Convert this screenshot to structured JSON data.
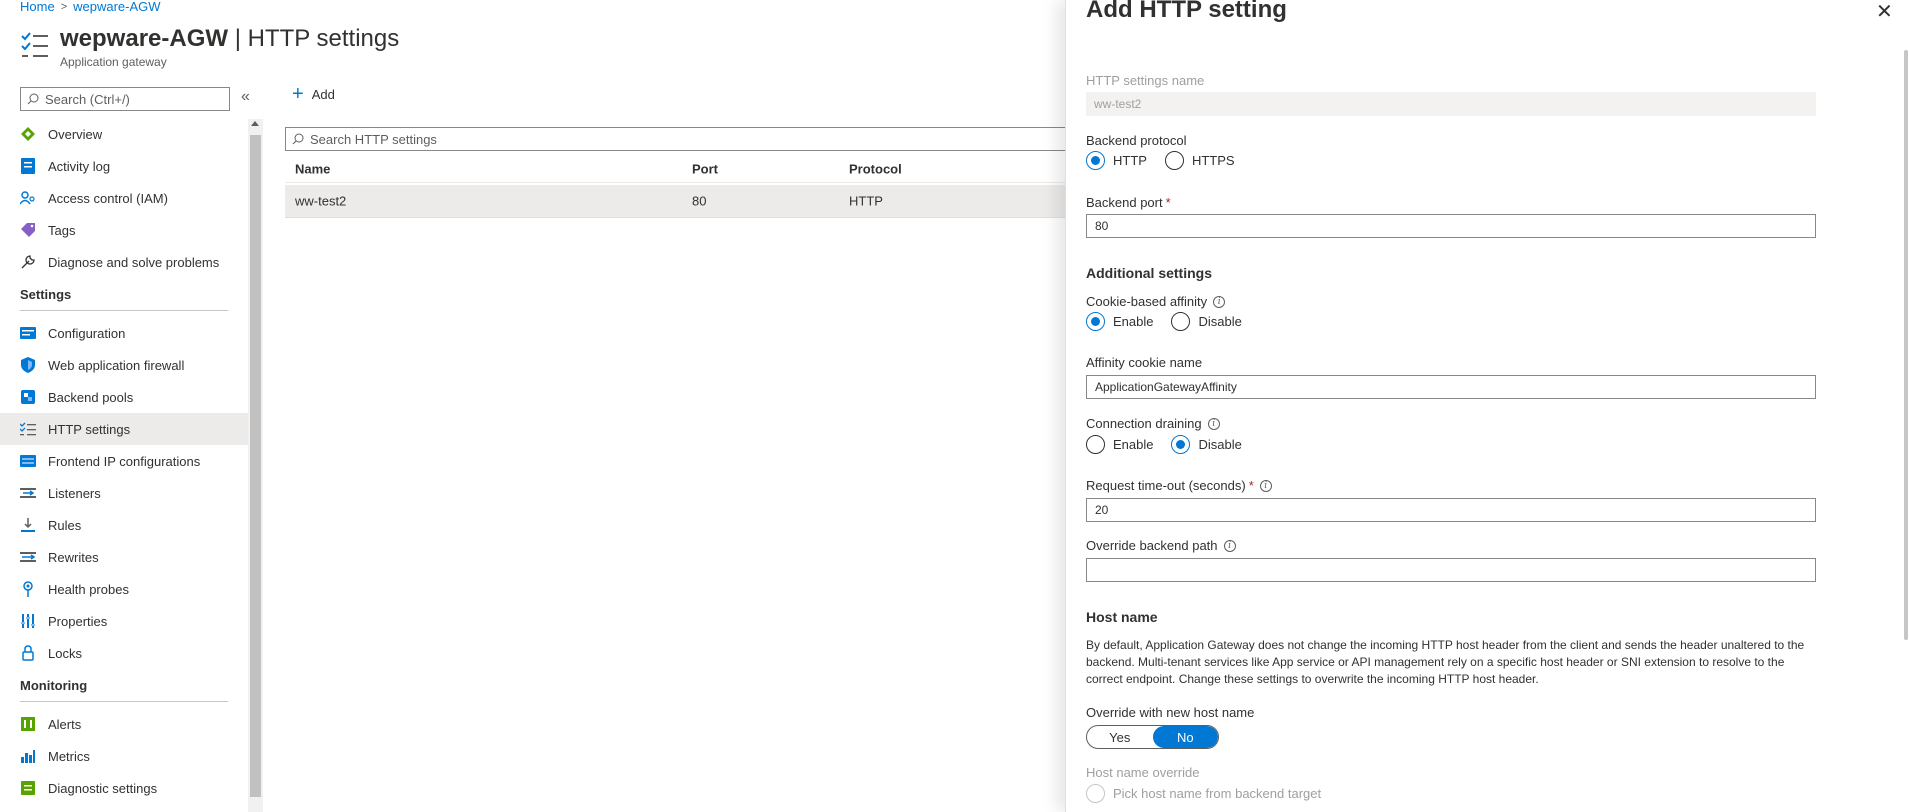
{
  "breadcrumb": {
    "home": "Home",
    "resource": "wepware-AGW",
    "sep": ">"
  },
  "header": {
    "resource": "wepware-AGW",
    "divider": " | ",
    "page": "HTTP settings",
    "subtitle": "Application gateway"
  },
  "sidebar": {
    "search_placeholder": "Search (Ctrl+/)",
    "collapse": "«",
    "items_top": [
      {
        "label": "Overview",
        "icon": "overview-icon"
      },
      {
        "label": "Activity log",
        "icon": "activity-log-icon"
      },
      {
        "label": "Access control (IAM)",
        "icon": "iam-icon"
      },
      {
        "label": "Tags",
        "icon": "tag-icon"
      },
      {
        "label": "Diagnose and solve problems",
        "icon": "wrench-icon"
      }
    ],
    "group_settings": "Settings",
    "items_settings": [
      {
        "label": "Configuration",
        "icon": "configuration-icon"
      },
      {
        "label": "Web application firewall",
        "icon": "shield-icon"
      },
      {
        "label": "Backend pools",
        "icon": "backend-pools-icon"
      },
      {
        "label": "HTTP settings",
        "icon": "list-check-icon",
        "selected": true
      },
      {
        "label": "Frontend IP configurations",
        "icon": "frontend-ip-icon"
      },
      {
        "label": "Listeners",
        "icon": "listener-icon"
      },
      {
        "label": "Rules",
        "icon": "rules-icon"
      },
      {
        "label": "Rewrites",
        "icon": "rewrites-icon"
      },
      {
        "label": "Health probes",
        "icon": "health-probe-icon"
      },
      {
        "label": "Properties",
        "icon": "properties-icon"
      },
      {
        "label": "Locks",
        "icon": "lock-icon"
      }
    ],
    "group_monitoring": "Monitoring",
    "items_monitoring": [
      {
        "label": "Alerts",
        "icon": "alerts-icon"
      },
      {
        "label": "Metrics",
        "icon": "metrics-icon"
      },
      {
        "label": "Diagnostic settings",
        "icon": "diagnostic-settings-icon"
      }
    ]
  },
  "commands": {
    "add": "Add"
  },
  "grid": {
    "search_placeholder": "Search HTTP settings",
    "columns": [
      "Name",
      "Port",
      "Protocol"
    ],
    "rows": [
      {
        "name": "ww-test2",
        "port": "80",
        "protocol": "HTTP"
      }
    ]
  },
  "panel": {
    "title": "Add HTTP setting",
    "close": "✕",
    "name_label": "HTTP settings name",
    "name_value": "ww-test2",
    "protocol_label": "Backend protocol",
    "protocol_options": [
      "HTTP",
      "HTTPS"
    ],
    "protocol_selected": "HTTP",
    "port_label": "Backend port",
    "required_mark": "*",
    "port_value": "80",
    "additional_heading": "Additional settings",
    "affinity_label": "Cookie-based affinity",
    "affinity_options": [
      "Enable",
      "Disable"
    ],
    "affinity_selected": "Enable",
    "affinity_cookie_label": "Affinity cookie name",
    "affinity_cookie_value": "ApplicationGatewayAffinity",
    "draining_label": "Connection draining",
    "draining_options": [
      "Enable",
      "Disable"
    ],
    "draining_selected": "Disable",
    "timeout_label": "Request time-out (seconds)",
    "timeout_value": "20",
    "override_path_label": "Override backend path",
    "override_path_value": "",
    "host_heading": "Host name",
    "host_desc": "By default, Application Gateway does not change the incoming HTTP host header from the client and sends the header unaltered to the backend. Multi-tenant services like App service or API management rely on a specific host header or SNI extension to resolve to the correct endpoint. Change these settings to overwrite the incoming HTTP host header.",
    "override_host_label": "Override with new host name",
    "toggle_yes": "Yes",
    "toggle_no": "No",
    "toggle_selected": "No",
    "host_override_label": "Host name override",
    "host_override_option": "Pick host name from backend target",
    "info_glyph": "i"
  }
}
